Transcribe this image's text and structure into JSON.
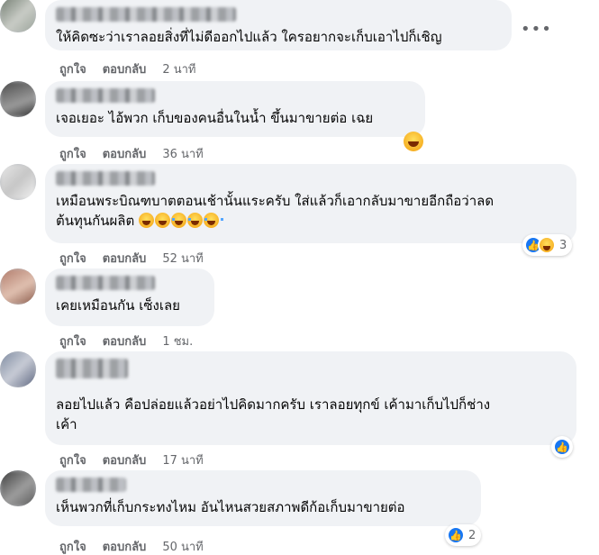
{
  "ui": {
    "like_label": "ถูกใจ",
    "reply_label": "ตอบกลับ"
  },
  "comments": [
    {
      "text": "ให้คิดซะว่าเราลอยสิ่งที่ไม่ดีออกไปแล้ว ใครอยากจะเก็บเอาไปก็เชิญ",
      "time": "2 นาที"
    },
    {
      "text": "เจอเยอะ ไอ้พวก เก็บของคนอื่นในน้ำ ขึ้นมาขายต่อ เฉย",
      "time": "36 นาที"
    },
    {
      "text_line1": "เหมือนพระบิณฑบาตตอนเช้านั้นแระครับ ใส่แล้วก็เอากลับมาขายอีกถือว่าลด",
      "text_line2": "ต้นทุนกันผลิต",
      "time": "52 นาที",
      "reaction_count": "3"
    },
    {
      "text": "เคยเหมือนกัน เซ็งเลย",
      "time": "1 ชม."
    },
    {
      "text_line1": "ลอยไปแล้ว คือปล่อยแล้วอย่าไปคิดมากครับ เราลอยทุกข์ เค้ามาเก็บไปก็ช่าง",
      "text_line2": "เค้า",
      "time": "17 นาที"
    },
    {
      "text": "เห็นพวกที่เก็บกระทงไหม อันไหนสวยสภาพดีก้อเก็บมาขายต่อ",
      "time": "50 นาที",
      "reaction_count": "2"
    }
  ],
  "icons": {
    "more": "more-options-icon",
    "like": "like-reaction-icon",
    "haha": "haha-reaction-icon"
  },
  "colors": {
    "bubble": "#f0f2f5",
    "meta_text": "#65676b",
    "like_blue": "#1877f2"
  }
}
